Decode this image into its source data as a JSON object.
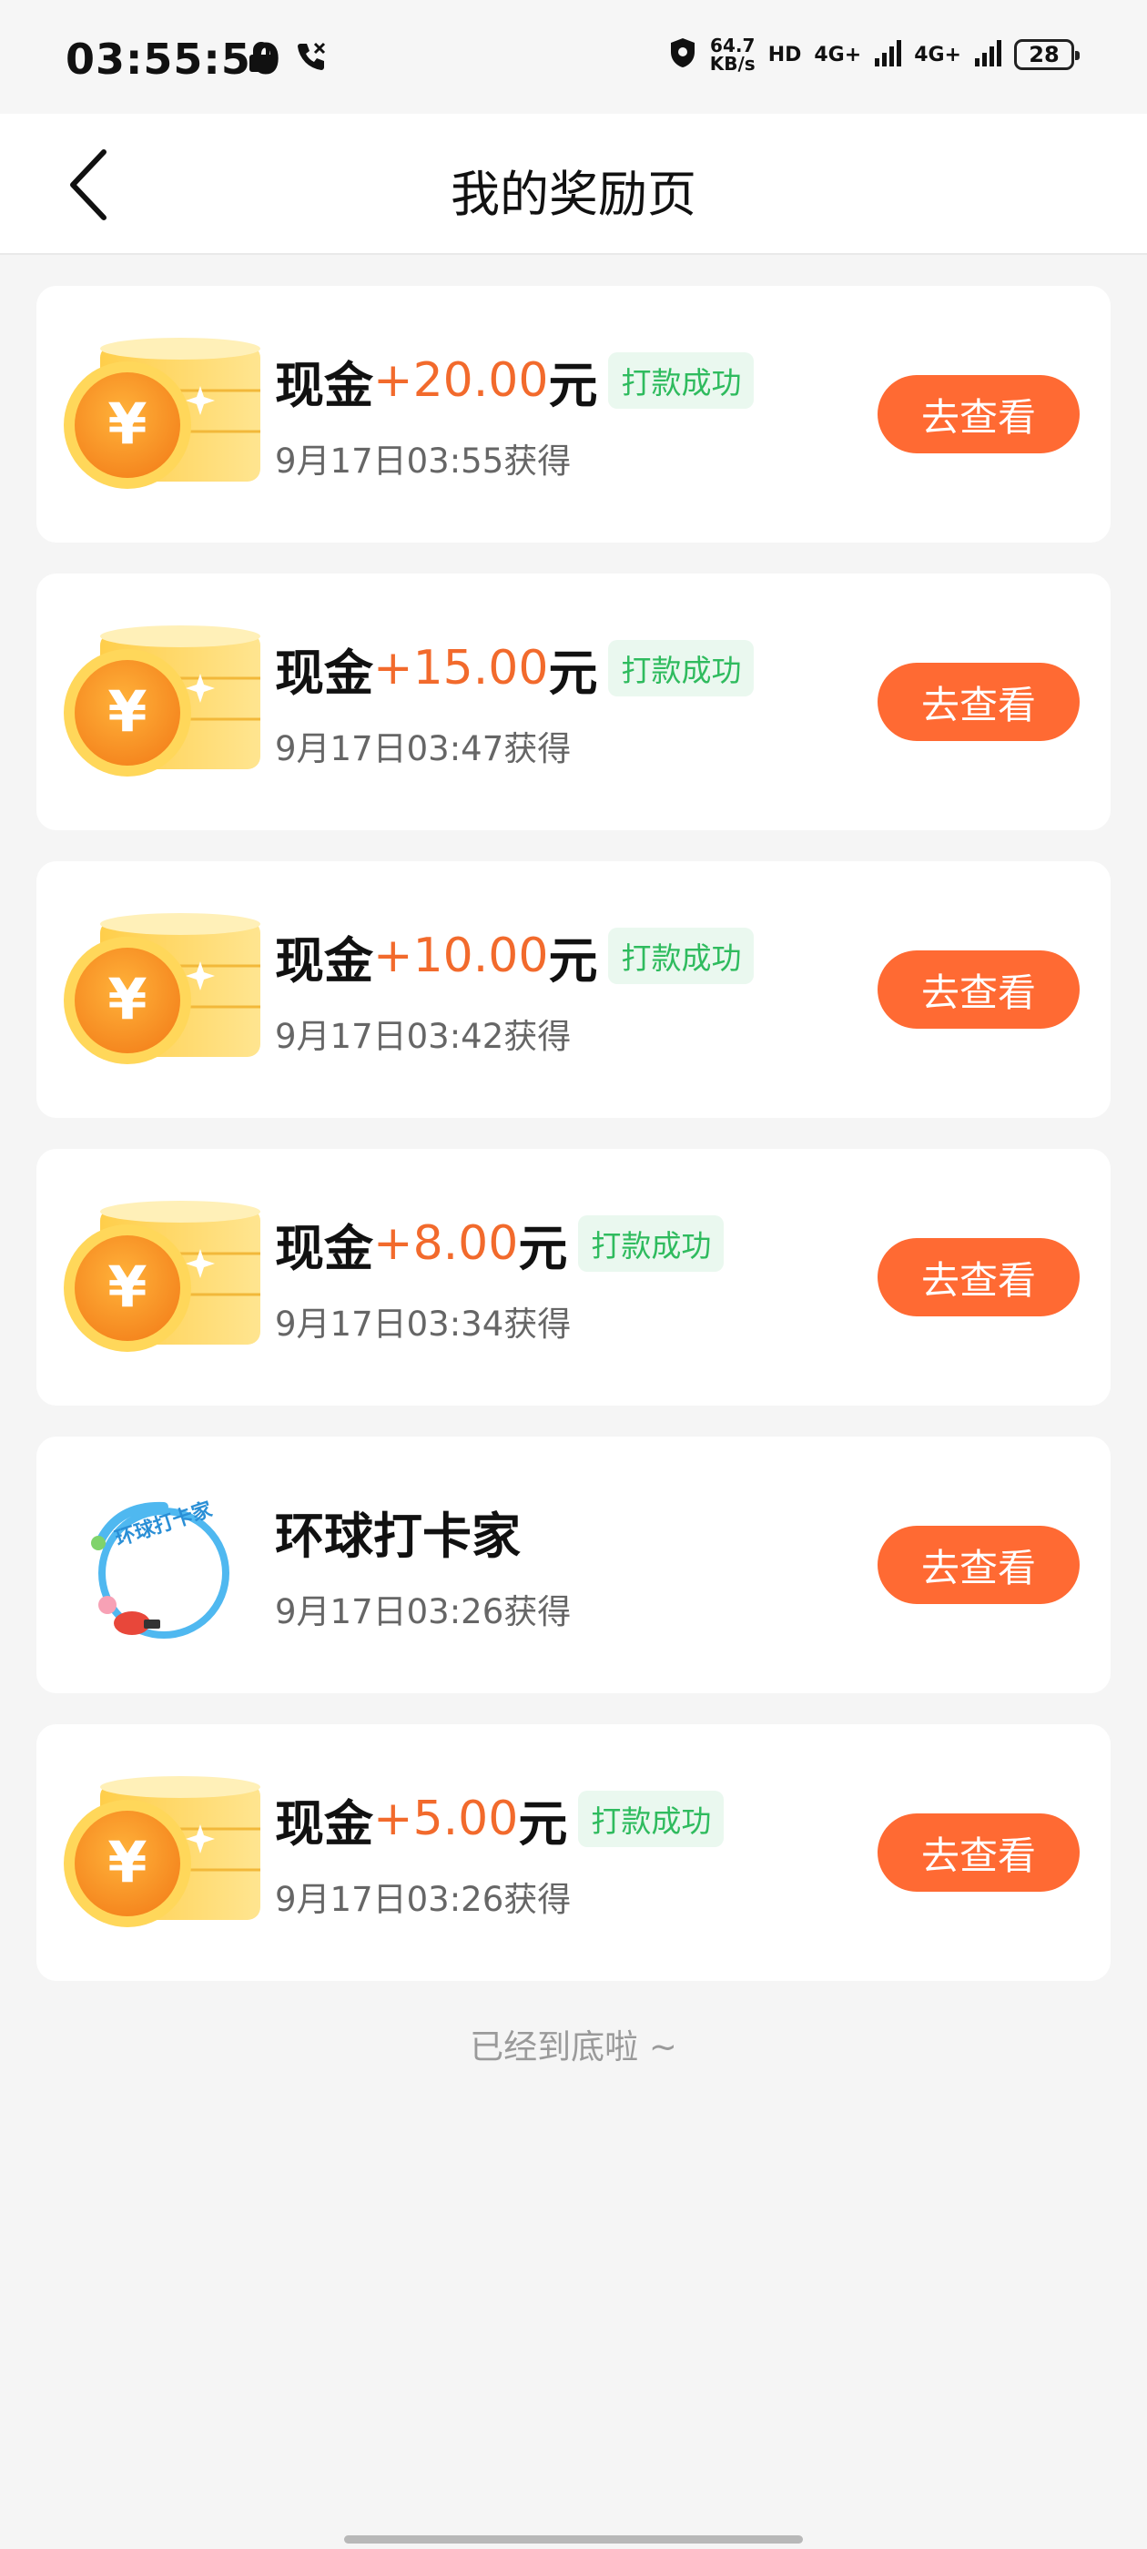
{
  "status_bar": {
    "time": "03:55:50",
    "network_speed_value": "64.7",
    "network_speed_unit": "KB/s",
    "hd_label": "HD",
    "signal1_label": "4G+",
    "signal2_label": "4G+",
    "battery": "28"
  },
  "header": {
    "title": "我的奖励页"
  },
  "rewards": [
    {
      "type": "cash",
      "label": "现金",
      "amount": "+20.00",
      "unit": "元",
      "status": "打款成功",
      "time": "9月17日03:55获得",
      "button": "去查看"
    },
    {
      "type": "cash",
      "label": "现金",
      "amount": "+15.00",
      "unit": "元",
      "status": "打款成功",
      "time": "9月17日03:47获得",
      "button": "去查看"
    },
    {
      "type": "cash",
      "label": "现金",
      "amount": "+10.00",
      "unit": "元",
      "status": "打款成功",
      "time": "9月17日03:42获得",
      "button": "去查看"
    },
    {
      "type": "cash",
      "label": "现金",
      "amount": "+8.00",
      "unit": "元",
      "status": "打款成功",
      "time": "9月17日03:34获得",
      "button": "去查看"
    },
    {
      "type": "badge",
      "label": "环球打卡家",
      "badge_text": "环球打卡家",
      "time": "9月17日03:26获得",
      "button": "去查看"
    },
    {
      "type": "cash",
      "label": "现金",
      "amount": "+5.00",
      "unit": "元",
      "status": "打款成功",
      "time": "9月17日03:26获得",
      "button": "去查看"
    }
  ],
  "footer": {
    "end_text": "已经到底啦 ~"
  },
  "colors": {
    "accent": "#ff6a33",
    "amount": "#f26a2c",
    "success": "#2fbb5e"
  }
}
